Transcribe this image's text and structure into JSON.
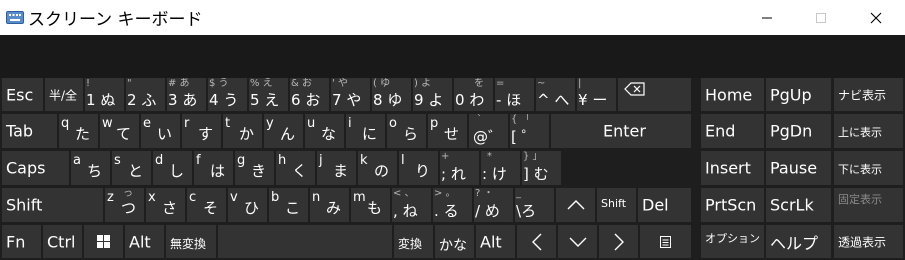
{
  "window": {
    "title": "スクリーン キーボード",
    "minimize": "—",
    "maximize": "☐",
    "close": "✕"
  },
  "row1": {
    "esc": "Esc",
    "hankaku": "半/全",
    "k1": {
      "sub": "!",
      "main": "1",
      "kana": "ぬ"
    },
    "k2": {
      "sub": "\"",
      "main": "2",
      "kana": "ふ"
    },
    "k3": {
      "sub": "# あ",
      "main": "3",
      "kana": "あ"
    },
    "k4": {
      "sub": "$ う",
      "main": "4",
      "kana": "う"
    },
    "k5": {
      "sub": "% え",
      "main": "5",
      "kana": "え"
    },
    "k6": {
      "sub": "& お",
      "main": "6",
      "kana": "お"
    },
    "k7": {
      "sub": "' や",
      "main": "7",
      "kana": "や"
    },
    "k8": {
      "sub": "( ゆ",
      "main": "8",
      "kana": "ゆ"
    },
    "k9": {
      "sub": ") よ",
      "main": "9",
      "kana": "よ"
    },
    "k0": {
      "sub": "を",
      "main": "0",
      "kana": "わ"
    },
    "kminus": {
      "sub": "=",
      "main": "-",
      "kana": "ほ"
    },
    "kcaret": {
      "sub": "~",
      "main": "^",
      "kana": "へ"
    },
    "kyen": {
      "sub": "|",
      "main": "¥",
      "kana": "ー"
    }
  },
  "row2": {
    "tab": "Tab",
    "keys": [
      {
        "l": "q",
        "k": "た"
      },
      {
        "l": "w",
        "k": "て"
      },
      {
        "l": "e",
        "k": "い"
      },
      {
        "l": "r",
        "k": "す"
      },
      {
        "l": "t",
        "k": "か"
      },
      {
        "l": "y",
        "k": "ん"
      },
      {
        "l": "u",
        "k": "な"
      },
      {
        "l": "i",
        "k": "に"
      },
      {
        "l": "o",
        "k": "ら"
      },
      {
        "l": "p",
        "k": "せ"
      }
    ],
    "at": {
      "sub": "`",
      "main": "@",
      "kana": "゛"
    },
    "lbracket": {
      "sub": "{ 「",
      "main": "[",
      "kana": "゜"
    },
    "enter": "Enter"
  },
  "row3": {
    "caps": "Caps",
    "keys": [
      {
        "l": "a",
        "k": "ち"
      },
      {
        "l": "s",
        "k": "と"
      },
      {
        "l": "d",
        "k": "し"
      },
      {
        "l": "f",
        "k": "は"
      },
      {
        "l": "g",
        "k": "き"
      },
      {
        "l": "h",
        "k": "く"
      },
      {
        "l": "j",
        "k": "ま"
      },
      {
        "l": "k",
        "k": "の"
      },
      {
        "l": "l",
        "k": "り"
      }
    ],
    "semi": {
      "sub": "+",
      "main": ";",
      "kana": "れ"
    },
    "colon": {
      "sub": "*",
      "main": ":",
      "kana": "け"
    },
    "rbracket": {
      "sub": "} 」",
      "main": "]",
      "kana": "む"
    }
  },
  "row4": {
    "shift": "Shift",
    "keys": [
      {
        "l": "z",
        "k": "つ",
        "s": "っ"
      },
      {
        "l": "x",
        "k": "さ"
      },
      {
        "l": "c",
        "k": "そ"
      },
      {
        "l": "v",
        "k": "ひ"
      },
      {
        "l": "b",
        "k": "こ"
      },
      {
        "l": "n",
        "k": "み"
      },
      {
        "l": "m",
        "k": "も"
      }
    ],
    "comma": {
      "sub": "< 、",
      "main": ",",
      "kana": "ね"
    },
    "period": {
      "sub": "> 。",
      "main": ".",
      "kana": "る"
    },
    "slash": {
      "sub": "? ・",
      "main": "/",
      "kana": "め"
    },
    "backslash": {
      "sub": "_",
      "main": "\\",
      "kana": "ろ"
    },
    "shift_right": "Shift",
    "del": "Del"
  },
  "row5": {
    "fn": "Fn",
    "ctrl": "Ctrl",
    "alt": "Alt",
    "muhenkan": "無変換",
    "henkan": "変換",
    "kana": "かな",
    "alt_right": "Alt"
  },
  "nav": {
    "home": "Home",
    "pgup": "PgUp",
    "navi": "ナビ表示",
    "end": "End",
    "pgdn": "PgDn",
    "up_display": "上に表示",
    "insert": "Insert",
    "pause": "Pause",
    "down_display": "下に表示",
    "prtscn": "PrtScn",
    "scrlk": "ScrLk",
    "dock": "固定表示",
    "options": "オプション",
    "help": "ヘルプ",
    "fade": "透過表示"
  },
  "colors": {
    "key_bg": "#333333",
    "background": "#1e1e1e",
    "titlebar": "#ffffff",
    "dim_text": "#8a8a8a"
  }
}
